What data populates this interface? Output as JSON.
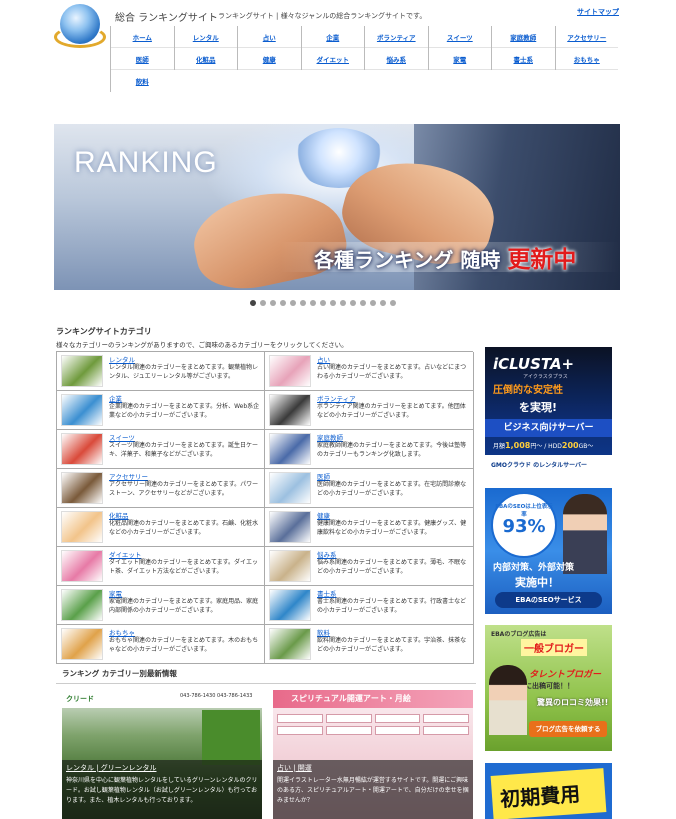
{
  "header": {
    "site_title": "総合 ランキングサイト",
    "site_desc": "ランキングサイト | 様々なジャンルの総合ランキングサイトです。",
    "sitemap": "サイトマップ"
  },
  "nav": [
    "ホーム",
    "レンタル",
    "占い",
    "企業",
    "ボランティア",
    "スイーツ",
    "家庭教師",
    "アクセサリー",
    "医師",
    "化粧品",
    "健康",
    "ダイエット",
    "悩み系",
    "家電",
    "書士系",
    "おもちゃ",
    "飲料"
  ],
  "banner": {
    "headline": "RANKING",
    "catch_a": "各種ランキング 随時",
    "catch_b": "更新中"
  },
  "slider": {
    "count": 15,
    "active": 0
  },
  "categories": {
    "title": "ランキングサイトカテゴリ",
    "intro": "様々なカテゴリーのランキングがありますので、ご興味のあるカテゴリーをクリックしてください。",
    "items": [
      {
        "name": "レンタル",
        "desc": "レンタル関連のカテゴリーをまとめてます。観葉植物レンタル、ジュエリーレンタル等がございます。",
        "color": "#6f9a3c"
      },
      {
        "name": "占い",
        "desc": "占い関連のカテゴリーをまとめてます。占いなどにまつわる小カテゴリーがございます。",
        "color": "#e7a3b9"
      },
      {
        "name": "企業",
        "desc": "企業関連のカテゴリーをまとめてます。分析、Web系企業などの小カテゴリーがございます。",
        "color": "#3b8fd1"
      },
      {
        "name": "ボランティア",
        "desc": "ボランティア関連のカテゴリーをまとめてます。他団体などの小カテゴリーがございます。",
        "color": "#3a3a3a"
      },
      {
        "name": "スイーツ",
        "desc": "スイーツ関連のカテゴリーをまとめてます。誕生日ケーキ、洋菓子、和菓子などがございます。",
        "color": "#d94a3a"
      },
      {
        "name": "家庭教師",
        "desc": "家庭教師関連のカテゴリーをまとめてます。今後は塾等のカテゴリーもランキング化致します。",
        "color": "#4a6aa8"
      },
      {
        "name": "アクセサリー",
        "desc": "アクセサリー関連のカテゴリーをまとめてます。パワーストーン、アクセサリーなどがございます。",
        "color": "#7a5a3a"
      },
      {
        "name": "医師",
        "desc": "医師関連のカテゴリーをまとめてます。在宅訪問診療などの小カテゴリーがございます。",
        "color": "#9cc0e0"
      },
      {
        "name": "化粧品",
        "desc": "化粧品関連のカテゴリーをまとめてます。石鹸、化粧水などの小カテゴリーがございます。",
        "color": "#f2c48a"
      },
      {
        "name": "健康",
        "desc": "健康関連のカテゴリーをまとめてます。健康グッズ、健康飲料などの小カテゴリーがございます。",
        "color": "#5a6f9a"
      },
      {
        "name": "ダイエット",
        "desc": "ダイエット関連のカテゴリーをまとめてます。ダイエット茶、ダイエット方法などがございます。",
        "color": "#e77aa6"
      },
      {
        "name": "悩み系",
        "desc": "悩み系関連のカテゴリーをまとめてます。薄毛、不眠などの小カテゴリーがございます。",
        "color": "#c9b28a"
      },
      {
        "name": "家電",
        "desc": "家電関連のカテゴリーをまとめてます。家庭用品、家庭内部関係の小カテゴリーがございます。",
        "color": "#5aa04a"
      },
      {
        "name": "書士系",
        "desc": "書士系関連のカテゴリーをまとめてます。行政書士などの小カテゴリーがございます。",
        "color": "#2f86c9"
      },
      {
        "name": "おもちゃ",
        "desc": "おもちゃ関連のカテゴリーをまとめてます。木のおもちゃなどの小カテゴリーがございます。",
        "color": "#e0a24a"
      },
      {
        "name": "飲料",
        "desc": "飲料関連のカテゴリーをまとめてます。宇治茶、抹茶などの小カテゴリーがございます。",
        "color": "#6a9a4a"
      }
    ]
  },
  "latest": {
    "title": "ランキング  カテゴリー別最新情報",
    "cards": [
      {
        "logo": "クリード",
        "tel": "043-786-1430  043-786-1433",
        "title": "レンタル | グリーンレンタル",
        "text": "神奈川県を中心に観葉植物レンタルをしているグリーンレンタルのクリード。お試し観葉植物レンタル（お試しグリーンレンタル）も行っております。また、植木レンタルも行っております。"
      },
      {
        "header": "スピリチュアル開運アート・月絵",
        "title": "占い | 開運",
        "text": "開運イラストレーター水無月暢紘が運営するサイトです。開運にご興味のある方、スピリチュアルアート・開運アートで、自分だけの幸せを掴みませんか？"
      }
    ]
  },
  "ads": {
    "iclusta": {
      "brand": "iCLUSTA+",
      "sub": "アイクラスタプラス",
      "l1": "圧倒的な安定性",
      "l2": "を実現!",
      "l3": "ビジネス向けサーバー",
      "price_a": "1,008",
      "price_b": "200",
      "l4_a": "月額",
      "l4_b": "円～ / HDD",
      "l4_c": "GB～",
      "foot": "GMOクラウド のレンタルサーバー"
    },
    "eba_seo": {
      "badge_text": "EBAのSEOは上位表示率",
      "badge_pct": "93%",
      "l1": "内部対策、外部対策",
      "l2": "実施中！",
      "foot": "EBAのSEOサービス"
    },
    "eba_blog": {
      "l1": "EBAのブログ広告は",
      "l2": "一般ブロガー",
      "l3": "タレントブロガー",
      "l4": "に出稿可能！！",
      "l5": "驚異のロコミ効果!!",
      "foot": "ブログ広告を依頼する"
    },
    "initial": {
      "text": "初期費用"
    }
  }
}
